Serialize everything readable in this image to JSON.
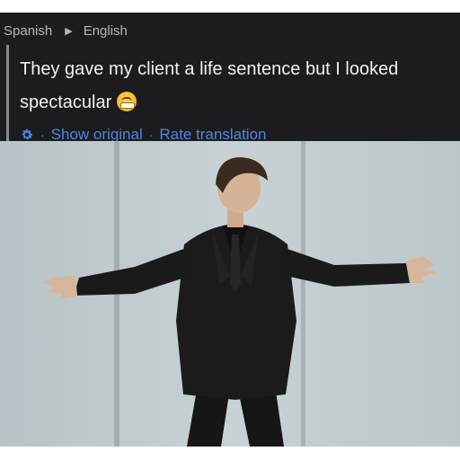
{
  "translation_card": {
    "source_language": "Spanish",
    "target_language": "English",
    "translated_text": "They gave my client a life sentence but I looked spectacular",
    "emoji_icon": "grimacing-face-emoji",
    "actions": {
      "settings_icon": "gear-icon",
      "show_original_label": "Show original",
      "separator": "·",
      "rate_translation_label": "Rate translation"
    }
  },
  "photo": {
    "subject": "man-in-black-suit-arms-outstretched"
  },
  "colors": {
    "card_background": "#1c1c1e",
    "link_blue": "#4f86e8",
    "wall": "#c4cfd2"
  }
}
